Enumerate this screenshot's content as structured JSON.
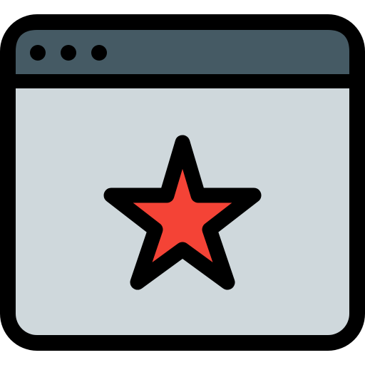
{
  "icon": {
    "name": "browser-window-star-icon",
    "colors": {
      "outline": "#000000",
      "titlebar": "#455A64",
      "content": "#CFD8DC",
      "star": "#F44336",
      "dots": "#000000"
    },
    "title_bar_dots": 3,
    "content_symbol": "star-icon"
  }
}
